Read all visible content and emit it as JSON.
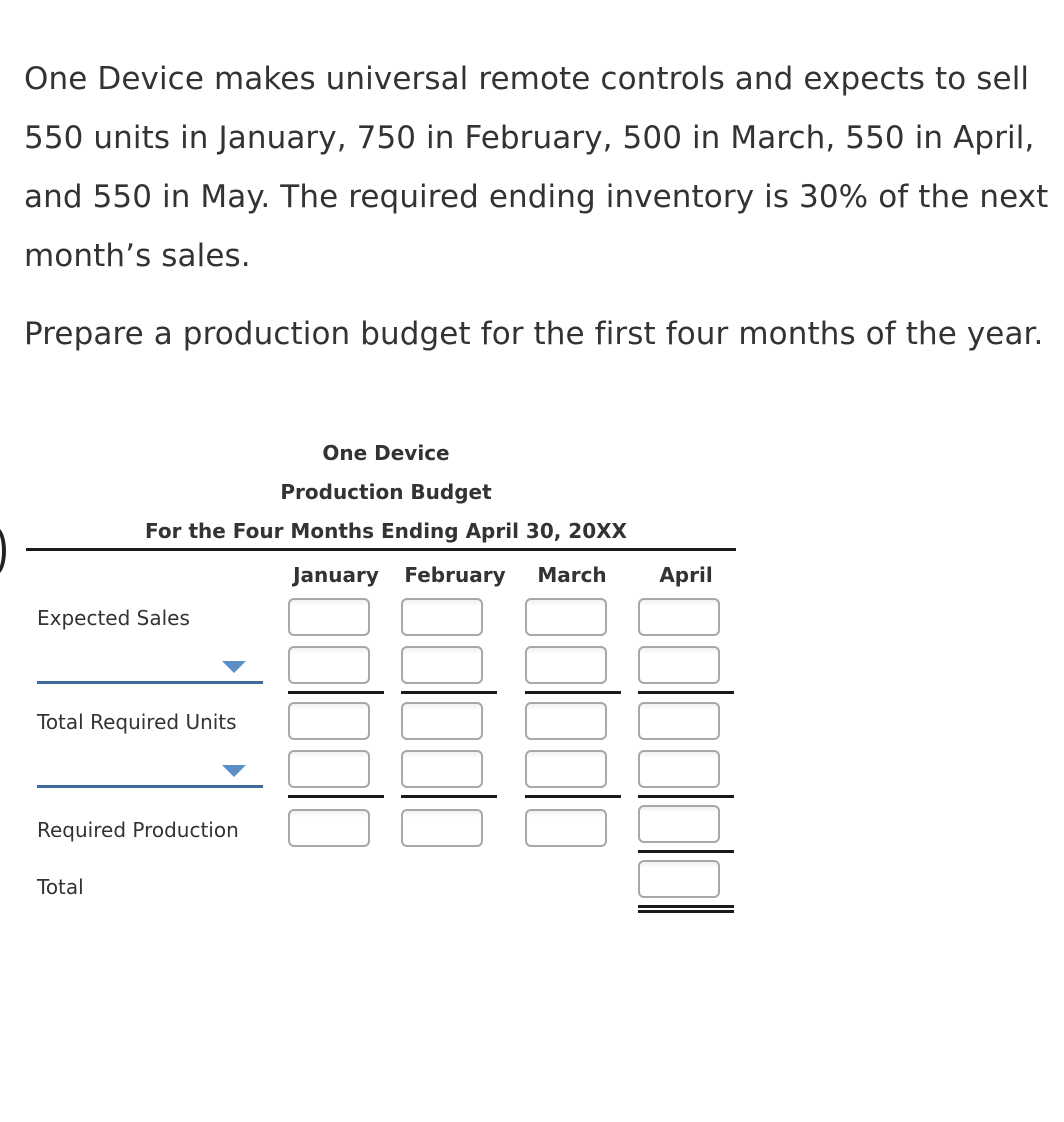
{
  "problem": {
    "paragraph_1": "One Device makes universal remote controls and expects to sell 550 units in January, 750 in February, 500 in March, 550 in April, and 550 in May. The required ending inventory is 30% of the next month’s sales.",
    "paragraph_2": "Prepare a production budget for the first four months of the year."
  },
  "budget": {
    "company": "One Device",
    "title": "Production Budget",
    "period": "For the Four Months Ending April 30, 20XX",
    "columns": [
      "January",
      "February",
      "March",
      "April"
    ],
    "rows": {
      "expected_sales": {
        "label": "Expected Sales",
        "values": [
          "",
          "",
          "",
          ""
        ]
      },
      "dropdown_1": {
        "selected": "",
        "values": [
          "",
          "",
          "",
          ""
        ]
      },
      "total_required_units": {
        "label": "Total Required Units",
        "values": [
          "",
          "",
          "",
          ""
        ]
      },
      "dropdown_2": {
        "selected": "",
        "values": [
          "",
          "",
          "",
          ""
        ]
      },
      "required_production": {
        "label": "Required Production",
        "values": [
          "",
          "",
          "",
          ""
        ]
      },
      "total": {
        "label": "Total",
        "value": ""
      }
    }
  },
  "colors": {
    "dropdown_line": "#3e6b9a",
    "dropdown_arrow": "#5b8fc6",
    "text": "#333333"
  }
}
